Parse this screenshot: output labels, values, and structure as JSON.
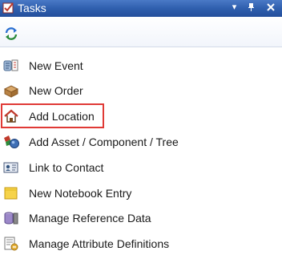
{
  "window": {
    "title": "Tasks",
    "icon": "tasks-checkbox-icon",
    "dropdown_glyph": "▾",
    "pin_glyph": "ᛘ",
    "close_glyph": "✕"
  },
  "toolbar": {
    "refresh_icon": "refresh-icon"
  },
  "tasks": [
    {
      "label": "New Event",
      "icon": "new-event-icon"
    },
    {
      "label": "New Order",
      "icon": "new-order-icon"
    },
    {
      "label": "Add Location",
      "icon": "house-icon",
      "highlighted": true
    },
    {
      "label": "Add Asset / Component / Tree",
      "icon": "asset-icon"
    },
    {
      "label": "Link to Contact",
      "icon": "contact-card-icon"
    },
    {
      "label": "New Notebook Entry",
      "icon": "notebook-icon"
    },
    {
      "label": "Manage Reference Data",
      "icon": "database-icon"
    },
    {
      "label": "Manage Attribute Definitions",
      "icon": "attribute-definitions-icon"
    }
  ],
  "colors": {
    "titlebar": "#2f5fae",
    "highlight_border": "#e03a36"
  }
}
